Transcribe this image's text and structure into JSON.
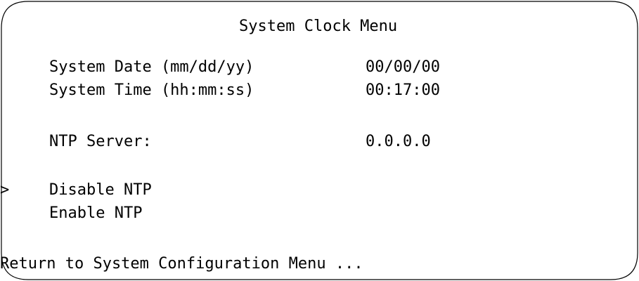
{
  "menu": {
    "title": "System Clock Menu",
    "system_date_label": "System Date (mm/dd/yy)",
    "system_date_value": "00/00/00",
    "system_time_label": "System Time (hh:mm:ss)",
    "system_time_value": "00:17:00",
    "ntp_server_label": "NTP Server:",
    "ntp_server_value": "0.0.0.0",
    "cursor": ">",
    "options": [
      {
        "label": "Disable NTP"
      },
      {
        "label": "Enable NTP"
      }
    ],
    "return_label": "Return to System Configuration Menu ..."
  }
}
